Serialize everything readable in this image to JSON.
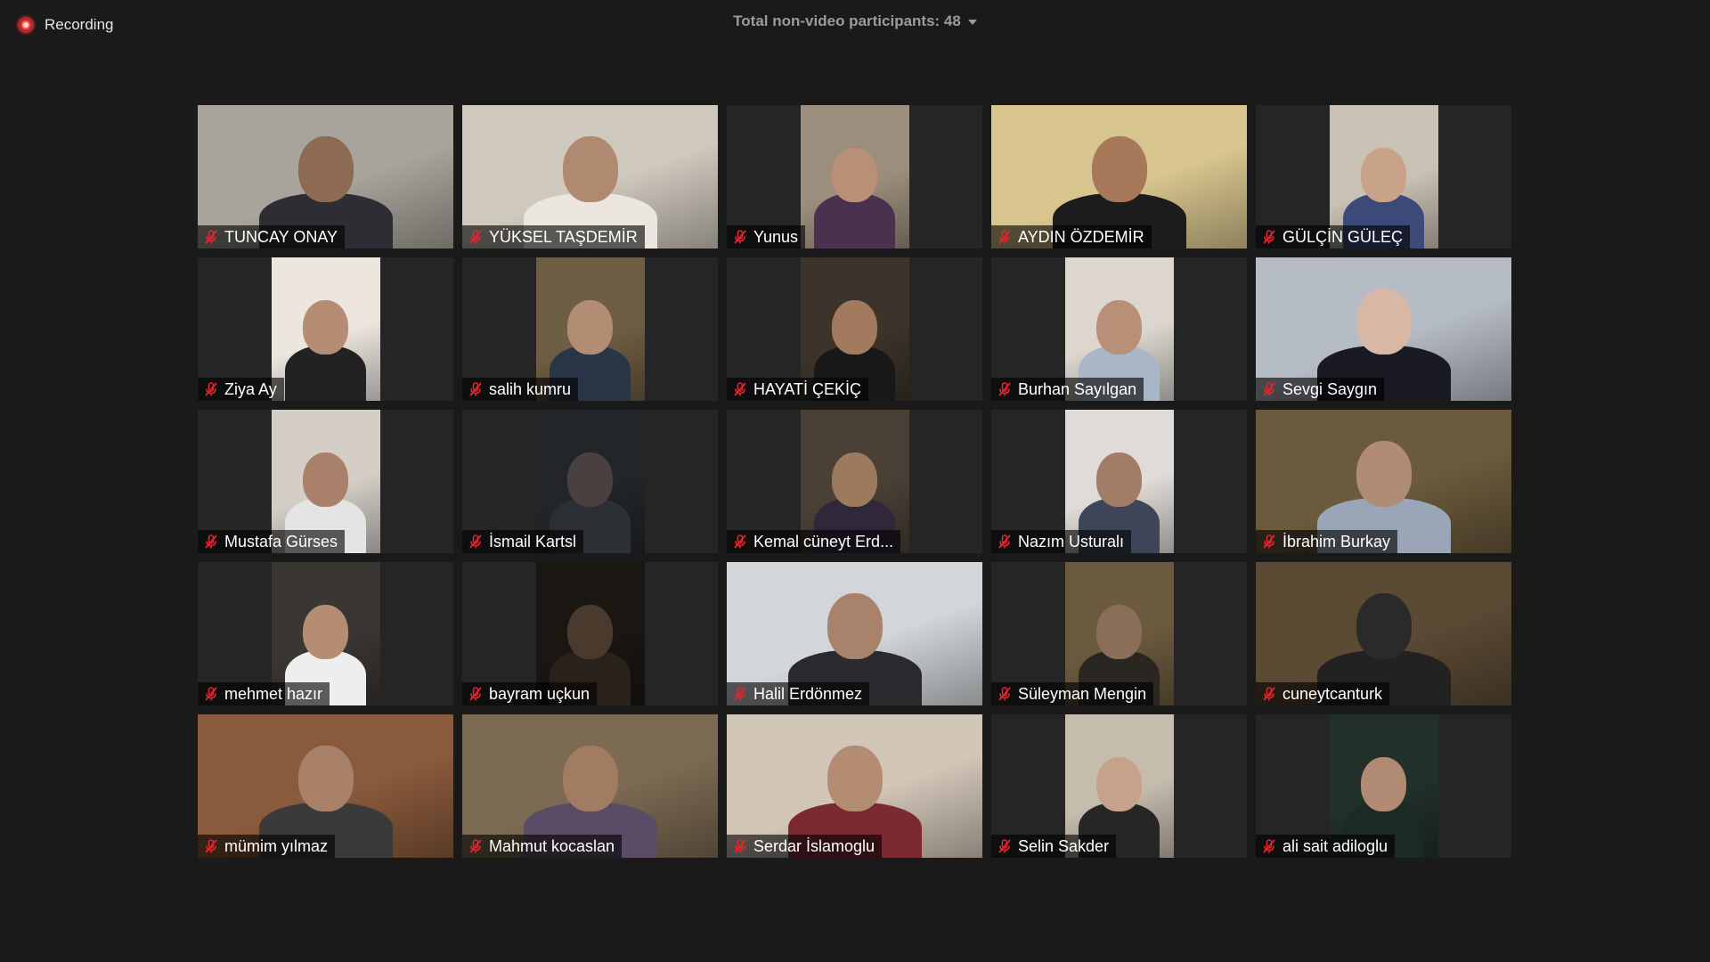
{
  "recording": {
    "label": "Recording"
  },
  "header": {
    "participants_label": "Total non-video participants: 48"
  },
  "tiles": [
    {
      "name": "TUNCAY ONAY",
      "muted": true,
      "video": {
        "full": true,
        "bg": "#a9a49b",
        "skin": "#8d6a52",
        "shirt": "#2e2d33"
      }
    },
    {
      "name": "YÜKSEL TAŞDEMİR",
      "muted": true,
      "video": {
        "full": true,
        "bg": "#cfc8bd",
        "skin": "#b08a70",
        "shirt": "#ebe7e0"
      }
    },
    {
      "name": "Yunus",
      "muted": true,
      "video": {
        "full": false,
        "bg": "#9c8e7c",
        "skin": "#b99076",
        "shirt": "#4a3150"
      }
    },
    {
      "name": "AYDIN ÖZDEMİR",
      "muted": true,
      "video": {
        "full": true,
        "bg": "#d9c68f",
        "skin": "#a8785a",
        "shirt": "#1c1c1c"
      }
    },
    {
      "name": "GÜLÇİN GÜLEÇ",
      "muted": true,
      "video": {
        "full": false,
        "bg": "#c9c1b4",
        "skin": "#c8a38a",
        "shirt": "#3b4a78"
      }
    },
    {
      "name": "Ziya Ay",
      "muted": true,
      "video": {
        "full": false,
        "bg": "#ece6de",
        "skin": "#b58d74",
        "shirt": "#222222"
      }
    },
    {
      "name": "salih kumru",
      "muted": true,
      "video": {
        "full": false,
        "bg": "#6e5e44",
        "skin": "#b38c74",
        "shirt": "#2b3548"
      }
    },
    {
      "name": "HAYATİ ÇEKİÇ",
      "muted": true,
      "video": {
        "full": false,
        "bg": "#3c342a",
        "skin": "#a27a5e",
        "shirt": "#181818"
      }
    },
    {
      "name": "Burhan Sayılgan",
      "muted": true,
      "video": {
        "full": false,
        "bg": "#dcd6cf",
        "skin": "#b89078",
        "shirt": "#a8b6c8"
      }
    },
    {
      "name": "Sevgi Saygın",
      "muted": true,
      "video": {
        "full": true,
        "bg": "#b6bcc6",
        "skin": "#d8b8a4",
        "shirt": "#1a1a22"
      }
    },
    {
      "name": "Mustafa Gürses",
      "muted": true,
      "video": {
        "full": false,
        "bg": "#d4cec6",
        "skin": "#a9806a",
        "shirt": "#e4e4e4"
      }
    },
    {
      "name": "İsmail Kartsl",
      "muted": true,
      "video": {
        "full": false,
        "bg": "#232628",
        "skin": "#4a4040",
        "shirt": "#2c2f33"
      }
    },
    {
      "name": "Kemal cüneyt Erd...",
      "muted": true,
      "video": {
        "full": false,
        "bg": "#4a4036",
        "skin": "#9c7a5e",
        "shirt": "#30283a"
      }
    },
    {
      "name": "Nazım Usturalı",
      "muted": true,
      "video": {
        "full": false,
        "bg": "#e0dbd6",
        "skin": "#a17c66",
        "shirt": "#3c4658"
      }
    },
    {
      "name": "İbrahim Burkay",
      "muted": true,
      "video": {
        "full": true,
        "bg": "#6b5a3c",
        "skin": "#b08c74",
        "shirt": "#9aa6b8"
      }
    },
    {
      "name": "mehmet hazır",
      "muted": true,
      "video": {
        "full": false,
        "bg": "#3a3632",
        "skin": "#b48d72",
        "shirt": "#eeeeee"
      }
    },
    {
      "name": "bayram uçkun",
      "muted": true,
      "video": {
        "full": false,
        "bg": "#1a1612",
        "skin": "#4a3a2e",
        "shirt": "#2a221c"
      }
    },
    {
      "name": "Halil Erdönmez",
      "muted": true,
      "video": {
        "full": true,
        "bg": "#d2d6d8",
        "skin": "#a8826a",
        "shirt": "#2a2a2e"
      }
    },
    {
      "name": "Süleyman Mengin",
      "muted": true,
      "video": {
        "full": false,
        "bg": "#6c5a3e",
        "skin": "#8a6e58",
        "shirt": "#2a2622"
      }
    },
    {
      "name": "cuneytcanturk",
      "muted": true,
      "video": {
        "full": true,
        "bg": "#5b4a34",
        "skin": "#2a2a2a",
        "shirt": "#222222"
      }
    },
    {
      "name": "mümim yılmaz",
      "muted": true,
      "video": {
        "full": true,
        "bg": "#8a5a3c",
        "skin": "#a98068",
        "shirt": "#3a3a3a"
      }
    },
    {
      "name": "Mahmut kocaslan",
      "muted": true,
      "video": {
        "full": true,
        "bg": "#7c6a52",
        "skin": "#a27c62",
        "shirt": "#5a4c66"
      }
    },
    {
      "name": "Serdar İslamoglu",
      "muted": true,
      "video": {
        "full": true,
        "bg": "#d2c6b8",
        "skin": "#b48c72",
        "shirt": "#7a2a30"
      }
    },
    {
      "name": "Selin Sakder",
      "muted": true,
      "video": {
        "full": false,
        "bg": "#c6bcae",
        "skin": "#c6a28a",
        "shirt": "#262626"
      }
    },
    {
      "name": "ali sait adiloglu",
      "muted": true,
      "video": {
        "full": false,
        "bg": "#22302a",
        "skin": "#b08a72",
        "shirt": "#1c2a24"
      }
    }
  ],
  "colors": {
    "background": "#1a1a1a",
    "tile_background": "#252525",
    "mute_icon": "#e0262e",
    "recording_dot": "#e04040",
    "header_text": "#9b9b9b"
  },
  "icons": {
    "recording": "recording-dot-icon",
    "dropdown": "chevron-down-icon",
    "mute": "muted-microphone-icon"
  }
}
